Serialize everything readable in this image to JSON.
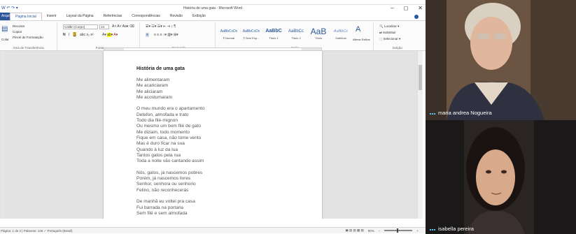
{
  "window": {
    "title": "História de uma gata - Microsoft Word",
    "controls": [
      "–",
      "◻",
      "✕"
    ]
  },
  "ribbon_tabs": [
    "Arquivo",
    "Página Inicial",
    "Inserir",
    "Layout da Página",
    "Referências",
    "Correspondências",
    "Revisão",
    "Exibição"
  ],
  "clipboard": {
    "paste": "Colar",
    "cut": "Recortar",
    "copy": "Copiar",
    "format_painter": "Pincel de Formatação",
    "group_label": "Área de Transferência"
  },
  "font": {
    "name": "Calibri (Corpo)",
    "size": "14",
    "group_label": "Fonte"
  },
  "paragraph": {
    "group_label": "Parágrafo"
  },
  "styles": {
    "items": [
      {
        "sample": "AaBbCcDc",
        "name": "¶ Normal"
      },
      {
        "sample": "AaBbCcDc",
        "name": "¶ Sem Esp..."
      },
      {
        "sample": "AaBbC",
        "name": "Título 1"
      },
      {
        "sample": "AaBbCc",
        "name": "Título 2"
      },
      {
        "sample": "AaB",
        "name": "Título"
      },
      {
        "sample": "AaBbCc",
        "name": "Subtítulo"
      }
    ],
    "change": "Alterar Estilos",
    "group_label": "Estilo"
  },
  "editing": {
    "find": "Localizar",
    "replace": "Substituir",
    "select": "Selecionar",
    "group_label": "Edição"
  },
  "document": {
    "title": "História de uma gata",
    "stanzas": [
      [
        "Me alimentaram",
        "Me acariciaram",
        "Me aliciaram",
        "Me acostumaram"
      ],
      [
        "O meu mundo era o apartamento",
        "Detefon, almofada e trato",
        "Todo dia filé-mignon",
        "Ou mesmo um bom filé de gato",
        "Me diziam, todo momento",
        "Fique em casa, não tome vento",
        "Mas é duro ficar na sua",
        "Quando à luz da lua",
        "Tantos gatos pela rua",
        "Toda a noite vão cantando assim"
      ],
      [
        "Nós, gatos, já nascemos pobres",
        "Porém, já nascemos livres",
        "Senhor, senhora ou senhorio",
        "Felino, não reconhecerás"
      ],
      [
        "De manhã eu voltei pra casa",
        "Fui barrada na portaria",
        "Sem filé e sem almofada"
      ]
    ]
  },
  "statusbar": {
    "page": "Página: 1 de 2",
    "words": "Palavras: 146",
    "language": "Português (Brasil)",
    "zoom": "90%"
  },
  "participants": [
    {
      "name": "maria andrea Nogueira"
    },
    {
      "name": "isabella pereira"
    }
  ]
}
